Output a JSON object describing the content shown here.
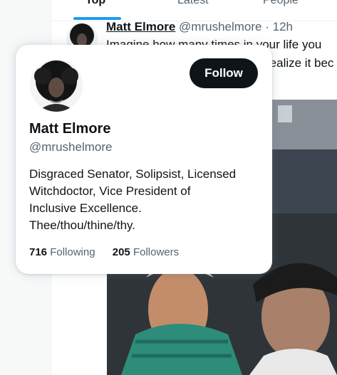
{
  "tabs": [
    {
      "label": "Top",
      "active": true
    },
    {
      "label": "Latest",
      "active": false
    },
    {
      "label": "People",
      "active": false
    }
  ],
  "tweet": {
    "author_name": "Matt Elmore",
    "author_handle": "@mrushelmore",
    "separator": "·",
    "time": "12h",
    "text_line_1": "Imagine how many times in your life you",
    "text_line_2": "realize it bec"
  },
  "hover_card": {
    "name": "Matt Elmore",
    "handle": "@mrushelmore",
    "follow_label": "Follow",
    "bio_lines": [
      "Disgraced Senator, Solipsist, Licensed",
      "Witchdoctor, Vice President of",
      "Inclusive Excellence.",
      "Thee/thou/thine/thy."
    ],
    "following_count": "716",
    "following_label": "Following",
    "followers_count": "205",
    "followers_label": "Followers"
  },
  "colors": {
    "accent": "#1d9bf0",
    "text": "#0f1419",
    "secondary_text": "#536471",
    "button_bg": "#0f1419"
  }
}
